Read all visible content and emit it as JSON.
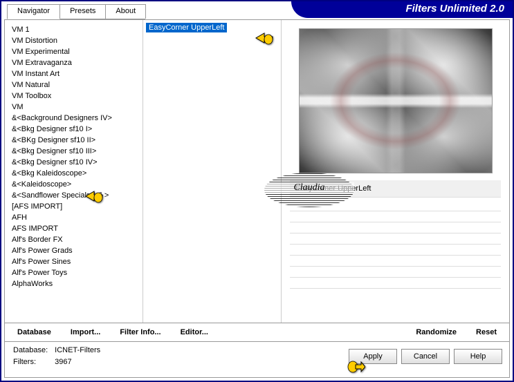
{
  "header": {
    "title": "Filters Unlimited 2.0"
  },
  "tabs": [
    {
      "label": "Navigator",
      "active": true
    },
    {
      "label": "Presets",
      "active": false
    },
    {
      "label": "About",
      "active": false
    }
  ],
  "navigator_items": [
    "VM 1",
    "VM Distortion",
    "VM Experimental",
    "VM Extravaganza",
    "VM Instant Art",
    "VM Natural",
    "VM Toolbox",
    "VM",
    "&<Background Designers IV>",
    "&<Bkg Designer sf10 I>",
    "&<BKg Designer sf10 II>",
    "&<Bkg Designer sf10 III>",
    "&<Bkg Designer sf10 IV>",
    "&<Bkg Kaleidoscope>",
    "&<Kaleidoscope>",
    "&<Sandflower Specials °v° >",
    "[AFS IMPORT]",
    "AFH",
    "AFS IMPORT",
    "Alf's Border FX",
    "Alf's Power Grads",
    "Alf's Power Sines",
    "Alf's Power Toys",
    "AlphaWorks"
  ],
  "filter_items": [
    {
      "label": "EasyCorner UpperLeft",
      "selected": true
    }
  ],
  "preview": {
    "filter_name": "EasyCorner UpperLeft"
  },
  "toolbar": {
    "database": "Database",
    "import": "Import...",
    "filter_info": "Filter Info...",
    "editor": "Editor...",
    "randomize": "Randomize",
    "reset": "Reset"
  },
  "footer": {
    "db_label": "Database:",
    "db_value": "ICNET-Filters",
    "filters_label": "Filters:",
    "filters_value": "3967",
    "apply": "Apply",
    "cancel": "Cancel",
    "help": "Help"
  },
  "watermark": "Claudia"
}
